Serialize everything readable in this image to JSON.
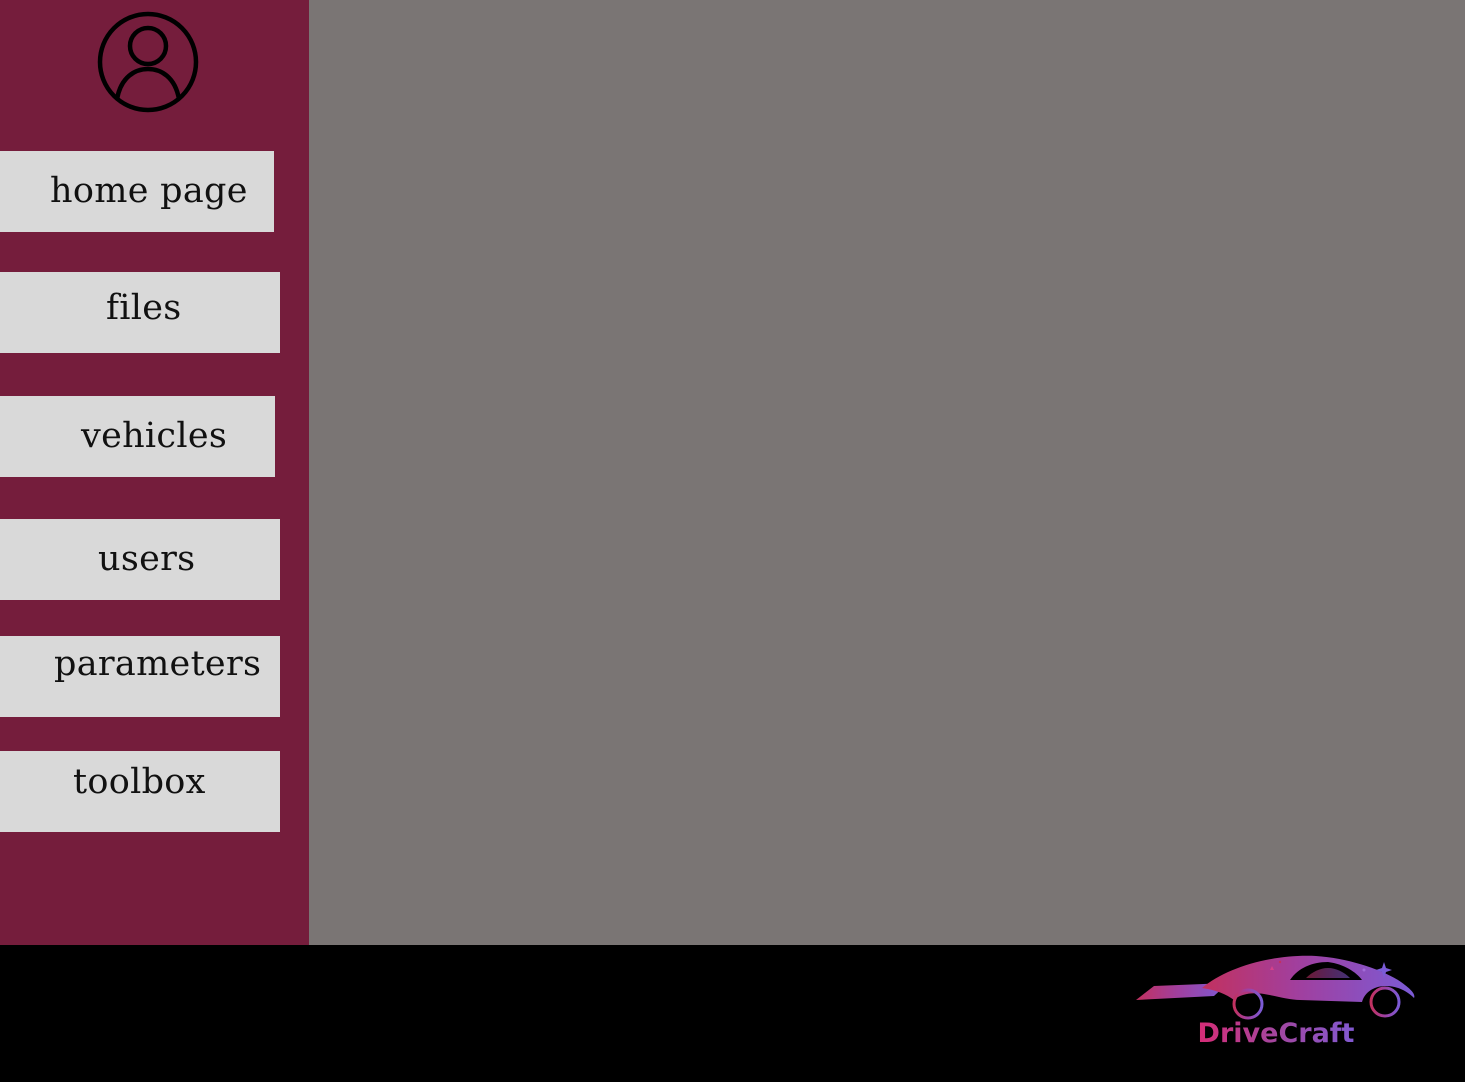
{
  "sidebar": {
    "avatar_icon": "user-circle-icon",
    "items": [
      {
        "id": "home",
        "label": "home page"
      },
      {
        "id": "files",
        "label": "files"
      },
      {
        "id": "vehicles",
        "label": "vehicles"
      },
      {
        "id": "users",
        "label": "users"
      },
      {
        "id": "parameters",
        "label": "parameters"
      },
      {
        "id": "toolbox",
        "label": "toolbox"
      }
    ]
  },
  "footer": {
    "logo": {
      "icon": "sports-car-icon",
      "text": "DriveCraft"
    }
  },
  "colors": {
    "sidebar": "#751d3c",
    "main": "#7a7574",
    "footer": "#000000",
    "button": "#d9d9d9"
  }
}
